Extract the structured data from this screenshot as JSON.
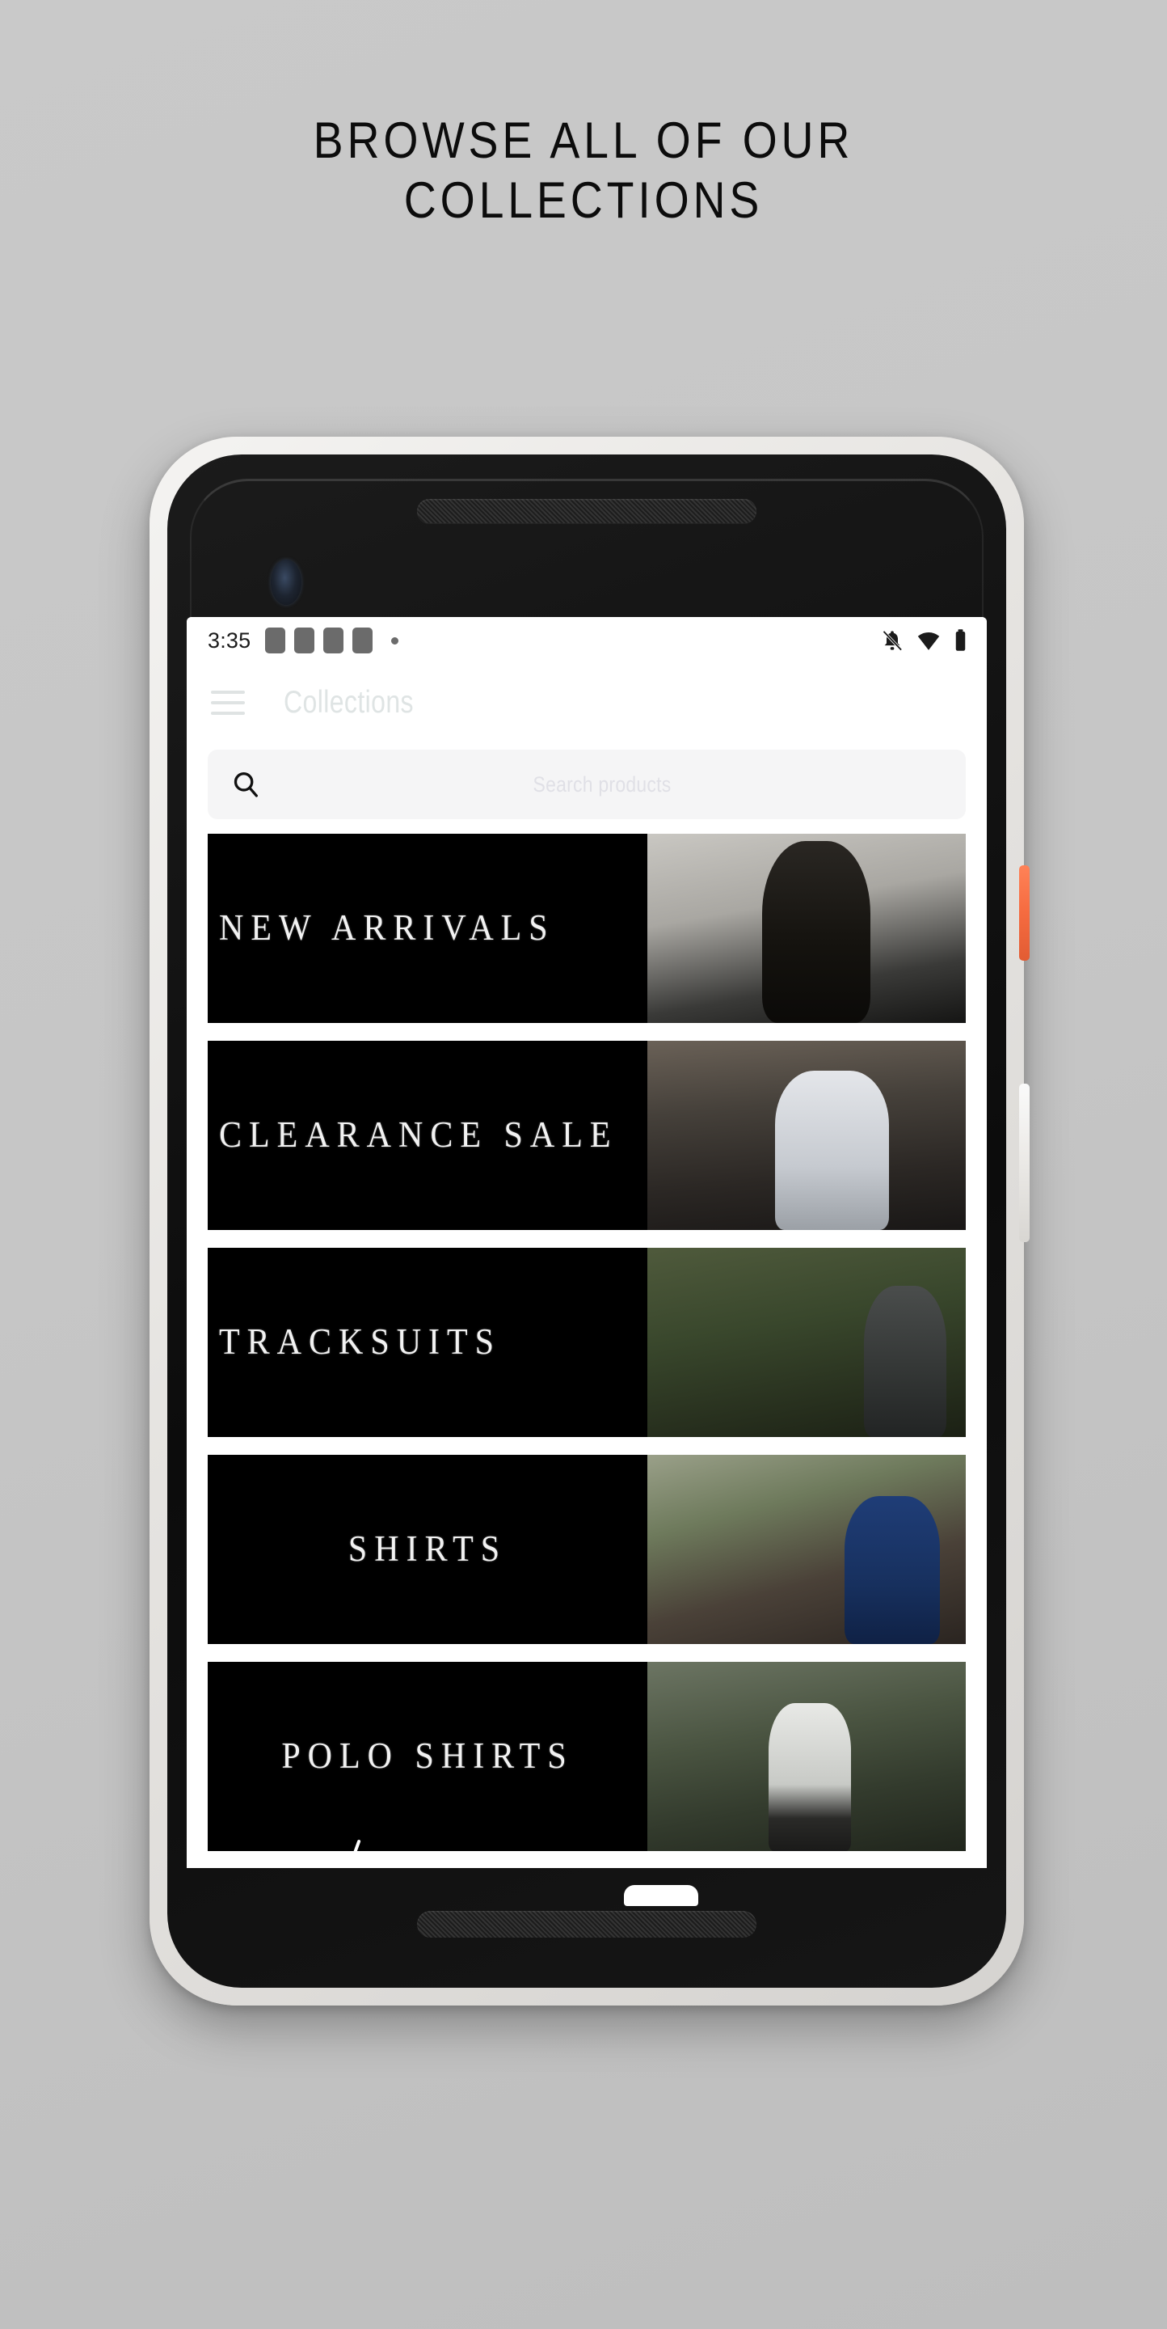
{
  "headline": {
    "line1": "BROWSE ALL OF OUR",
    "line2": "COLLECTIONS"
  },
  "device": {
    "frame_color": "#eceae7",
    "body_color": "#131313",
    "power_button_color": "#f56b40",
    "volume_button_color": "#ebe9e6"
  },
  "status_bar": {
    "time": "3:35",
    "notification_icons": [
      "app-square",
      "app-square",
      "app-square",
      "app-square",
      "more-dot"
    ],
    "right_icons": [
      "notifications-off-icon",
      "wifi-icon",
      "battery-icon"
    ]
  },
  "app_bar": {
    "menu_icon": "hamburger-menu-icon",
    "title": "Collections"
  },
  "search": {
    "icon": "search-icon",
    "placeholder": "Search products",
    "value": ""
  },
  "collections": [
    {
      "label": "NEW ARRIVALS",
      "align": "left",
      "scene": "scene1"
    },
    {
      "label": "CLEARANCE SALE",
      "align": "left",
      "scene": "scene2"
    },
    {
      "label": "TRACKSUITS",
      "align": "left",
      "scene": "scene3"
    },
    {
      "label": "SHIRTS",
      "align": "center",
      "scene": "scene4"
    },
    {
      "label": "POLO SHIRTS",
      "align": "center",
      "scene": "scene5"
    },
    {
      "label": "",
      "align": "left",
      "scene": "scene6"
    }
  ],
  "nav_bar": {
    "back_icon": "back-chevron-icon",
    "home_icon": "home-pill-icon"
  },
  "colors": {
    "page_background": "#c6c6c6",
    "card_background": "#000000",
    "card_text": "#f2f2f2",
    "appbar_title": "#dfe4e4",
    "search_background": "#f5f5f6",
    "placeholder_text": "#e0e0e6"
  }
}
